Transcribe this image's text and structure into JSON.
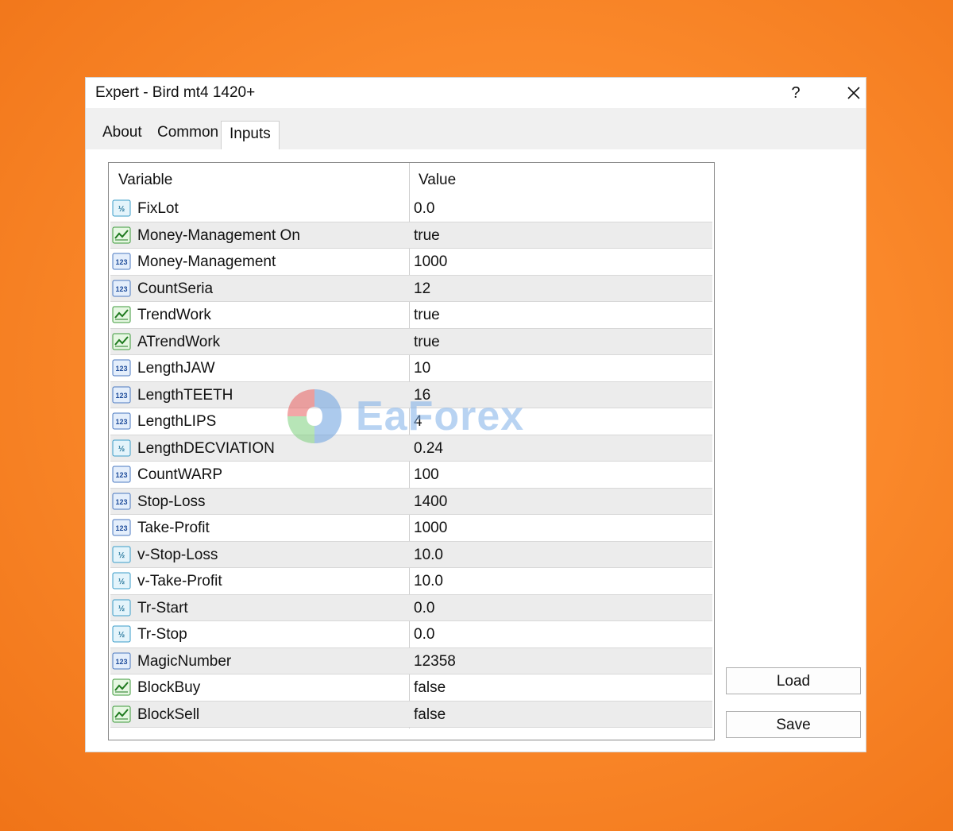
{
  "window": {
    "title": "Expert - Bird mt4 1420+",
    "help_label": "?"
  },
  "tabs": [
    {
      "label": "About"
    },
    {
      "label": "Common"
    },
    {
      "label": "Inputs"
    }
  ],
  "grid": {
    "headers": {
      "variable": "Variable",
      "value": "Value"
    },
    "rows": [
      {
        "type": "double",
        "name": "FixLot",
        "value": "0.0"
      },
      {
        "type": "bool",
        "name": "Money-Management On",
        "value": "true"
      },
      {
        "type": "int",
        "name": "Money-Management",
        "value": "1000"
      },
      {
        "type": "int",
        "name": "CountSeria",
        "value": "12"
      },
      {
        "type": "bool",
        "name": "TrendWork",
        "value": "true"
      },
      {
        "type": "bool",
        "name": "ATrendWork",
        "value": "true"
      },
      {
        "type": "int",
        "name": "LengthJAW",
        "value": "10"
      },
      {
        "type": "int",
        "name": "LengthTEETH",
        "value": "16"
      },
      {
        "type": "int",
        "name": "LengthLIPS",
        "value": "4"
      },
      {
        "type": "double",
        "name": "LengthDECVIATION",
        "value": "0.24"
      },
      {
        "type": "int",
        "name": "CountWARP",
        "value": "100"
      },
      {
        "type": "int",
        "name": "Stop-Loss",
        "value": "1400"
      },
      {
        "type": "int",
        "name": "Take-Profit",
        "value": "1000"
      },
      {
        "type": "double",
        "name": "v-Stop-Loss",
        "value": "10.0"
      },
      {
        "type": "double",
        "name": "v-Take-Profit",
        "value": "10.0"
      },
      {
        "type": "double",
        "name": "Tr-Start",
        "value": "0.0"
      },
      {
        "type": "double",
        "name": "Tr-Stop",
        "value": "0.0"
      },
      {
        "type": "int",
        "name": "MagicNumber",
        "value": "12358"
      },
      {
        "type": "bool",
        "name": "BlockBuy",
        "value": "false"
      },
      {
        "type": "bool",
        "name": "BlockSell",
        "value": "false"
      }
    ]
  },
  "buttons": {
    "load": "Load",
    "save": "Save"
  },
  "icons": {
    "int": "int-type-icon",
    "double": "double-type-icon",
    "bool": "bool-type-icon"
  },
  "watermark": {
    "text": "EaForex"
  }
}
